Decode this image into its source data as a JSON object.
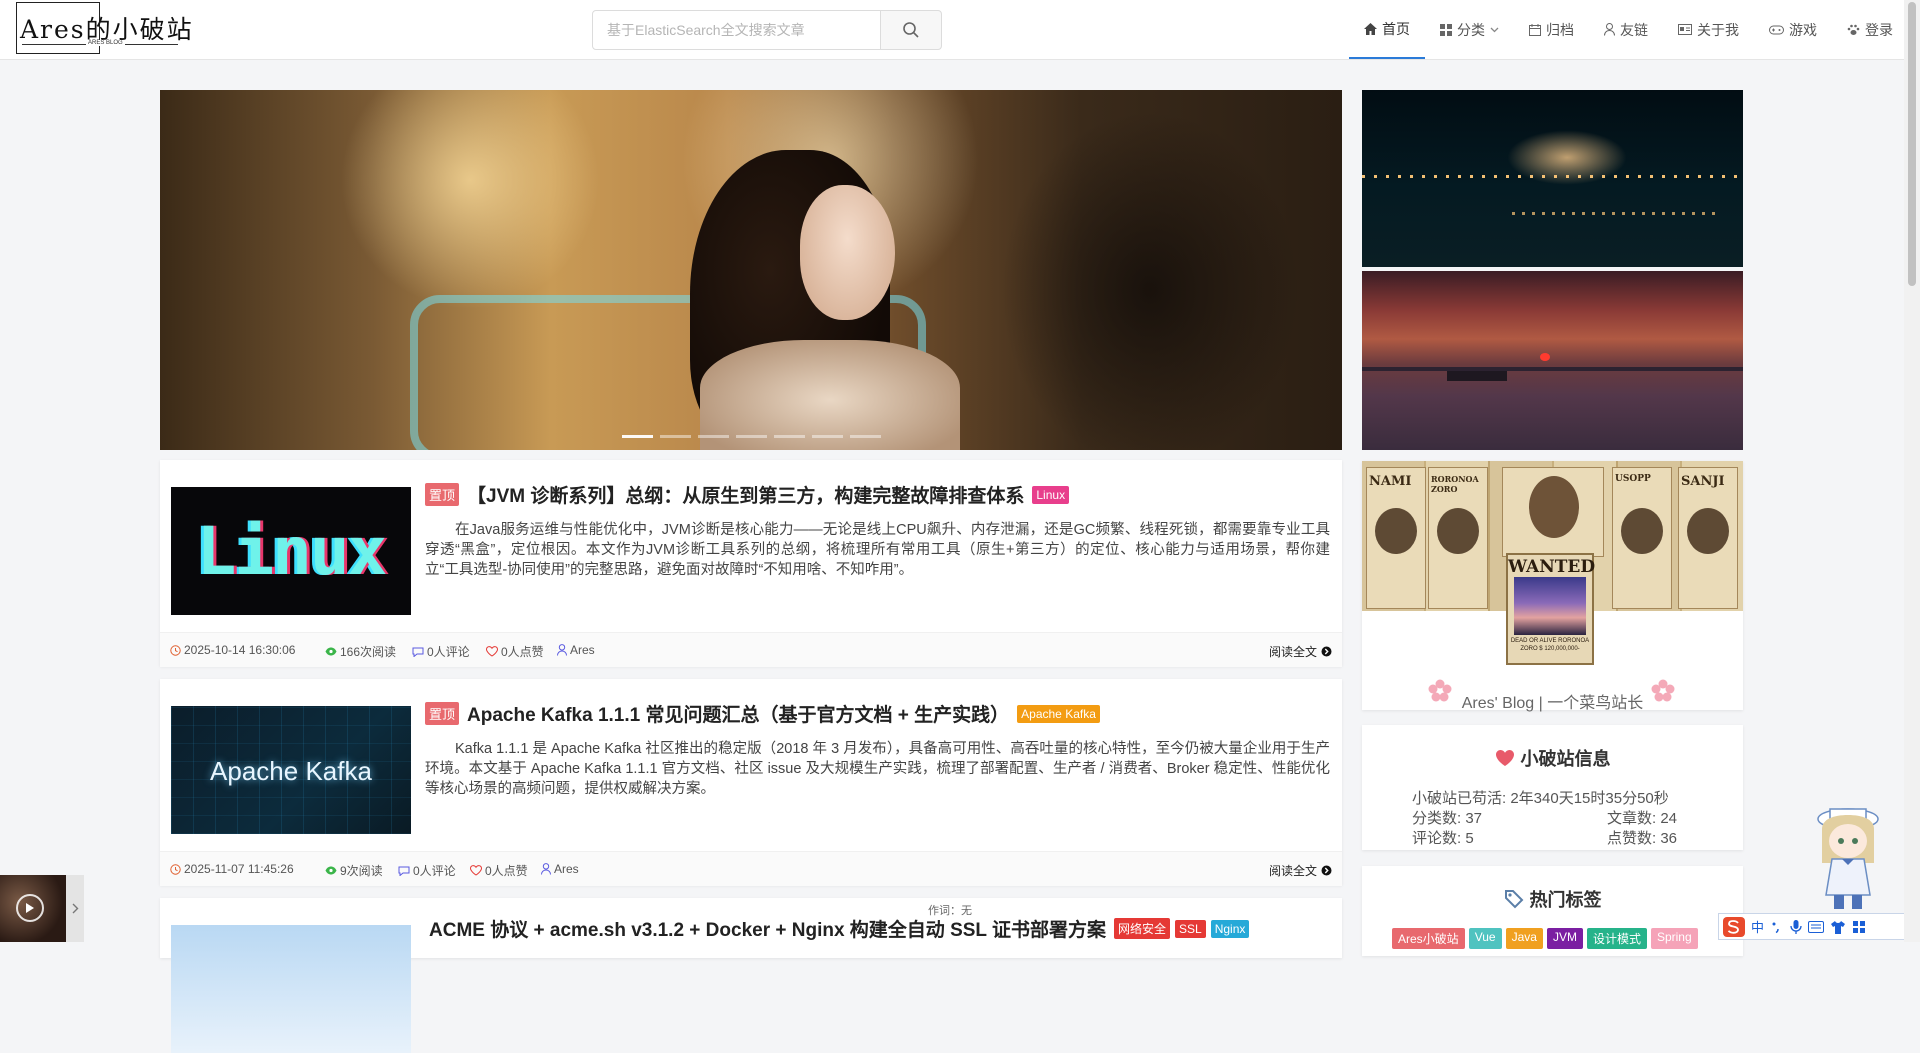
{
  "header": {
    "logo_text": "Ares的小破站",
    "logo_sub": "ARES BLOG",
    "search_placeholder": "基于ElasticSearch全文搜索文章",
    "nav": [
      {
        "label": "首页",
        "icon": "home-icon"
      },
      {
        "label": "分类",
        "icon": "grid-icon"
      },
      {
        "label": "归档",
        "icon": "calendar-icon"
      },
      {
        "label": "友链",
        "icon": "user-icon"
      },
      {
        "label": "关于我",
        "icon": "idcard-icon"
      },
      {
        "label": "游戏",
        "icon": "gamepad-icon"
      },
      {
        "label": "登录",
        "icon": "paw-icon"
      }
    ]
  },
  "articles": [
    {
      "top_badge": "置顶",
      "title": "【JVM 诊断系列】总纲：从原生到第三方，构建完整故障排查体系",
      "tags": [
        {
          "label": "Linux",
          "color": "#e83e8c"
        }
      ],
      "thumb_text": "Linux",
      "summary": "在Java服务运维与性能优化中，JVM诊断是核心能力——无论是线上CPU飙升、内存泄漏，还是GC频繁、线程死锁，都需要靠专业工具穿透“黑盒”，定位根因。本文作为JVM诊断工具系列的总纲，将梳理所有常用工具（原生+第三方）的定位、核心能力与适用场景，帮你建立“工具选型-协同使用”的完整思路，避免面对故障时“不知用啥、不知咋用”。",
      "date": "2025-10-14 16:30:06",
      "reads": "166次阅读",
      "comments": "0人评论",
      "likes": "0人点赞",
      "author": "Ares",
      "read_more": "阅读全文"
    },
    {
      "top_badge": "置顶",
      "title": "Apache Kafka 1.1.1 常见问题汇总（基于官方文档 + 生产实践）",
      "tags": [
        {
          "label": "Apache Kafka",
          "color": "#f39c12"
        }
      ],
      "thumb_text": "Apache Kafka",
      "summary": "Kafka 1.1.1 是 Apache Kafka 社区推出的稳定版（2018 年 3 月发布），具备高可用性、高吞吐量的核心特性，至今仍被大量企业用于生产环境。本文基于 Apache Kafka 1.1.1 官方文档、社区 issue 及大规模生产实践，梳理了部署配置、生产者 / 消费者、Broker 稳定性、性能优化等核心场景的高频问题，提供权威解决方案。",
      "date": "2025-11-07 11:45:26",
      "reads": "9次阅读",
      "comments": "0人评论",
      "likes": "0人点赞",
      "author": "Ares",
      "read_more": "阅读全文"
    },
    {
      "title": "ACME 协议 + acme.sh v3.1.2 + Docker + Nginx 构建全自动 SSL 证书部署方案",
      "tags": [
        {
          "label": "网络安全",
          "color": "#e53935"
        },
        {
          "label": "SSL",
          "color": "#e53935"
        },
        {
          "label": "Nginx",
          "color": "#26a9d8"
        }
      ]
    }
  ],
  "sidebar": {
    "profile_name": "Ares' Blog | 一个菜鸟站长",
    "wanted": "WANTED",
    "wanted_caption": "DEAD OR ALIVE\nRORONOA ZORO\n$ 120,000,000-",
    "posters": [
      "NAMI",
      "RORONOA ZORO",
      "WANTED",
      "USOPP",
      "SANJI"
    ],
    "site_info": {
      "title": "小破站信息",
      "uptime": "小破站已苟活: 2年340天15时35分50秒",
      "categories": "分类数: 37",
      "articles": "文章数: 24",
      "comments": "评论数: 5",
      "likes": "点赞数: 36"
    },
    "hot_tags": {
      "title": "热门标签",
      "tags": [
        {
          "label": "Ares小破站",
          "color": "#e8696e"
        },
        {
          "label": "Vue",
          "color": "#4fc3c0"
        },
        {
          "label": "Java",
          "color": "#f0a020"
        },
        {
          "label": "JVM",
          "color": "#7b1fa2"
        },
        {
          "label": "设计模式",
          "color": "#26b38a"
        },
        {
          "label": "Spring",
          "color": "#f5a3b8"
        }
      ]
    }
  },
  "player": {
    "lyric": "作词：无"
  },
  "ime": {
    "label": "中"
  }
}
